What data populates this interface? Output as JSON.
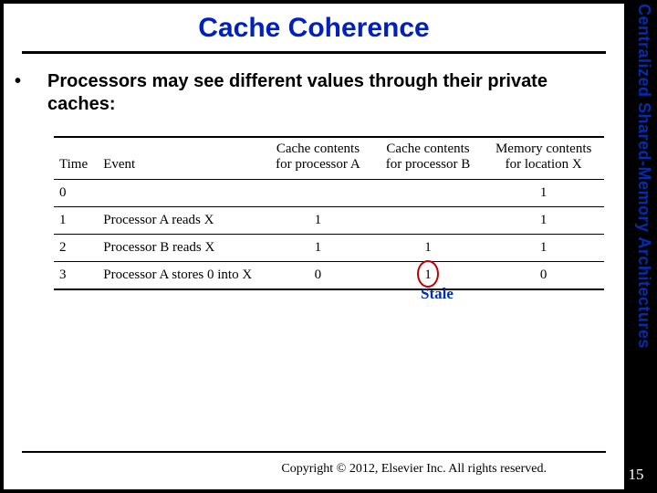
{
  "sideLabel": "Centralized Shared-Memory Architectures",
  "title": "Cache Coherence",
  "bullet": "Processors may see different values through their private caches:",
  "table": {
    "headers": {
      "time": "Time",
      "event": "Event",
      "cacheA": "Cache contents for processor A",
      "cacheB": "Cache contents for processor B",
      "memX": "Memory contents for location X"
    },
    "rows": [
      {
        "time": "0",
        "event": "",
        "a": "",
        "b": "",
        "m": "1"
      },
      {
        "time": "1",
        "event": "Processor A reads X",
        "a": "1",
        "b": "",
        "m": "1"
      },
      {
        "time": "2",
        "event": "Processor B reads X",
        "a": "1",
        "b": "1",
        "m": "1"
      },
      {
        "time": "3",
        "event": "Processor A stores 0 into X",
        "a": "0",
        "b": "1",
        "m": "0"
      }
    ]
  },
  "annotation": "Stale",
  "copyright": "Copyright © 2012, Elsevier Inc. All rights reserved.",
  "pageNumber": "15"
}
